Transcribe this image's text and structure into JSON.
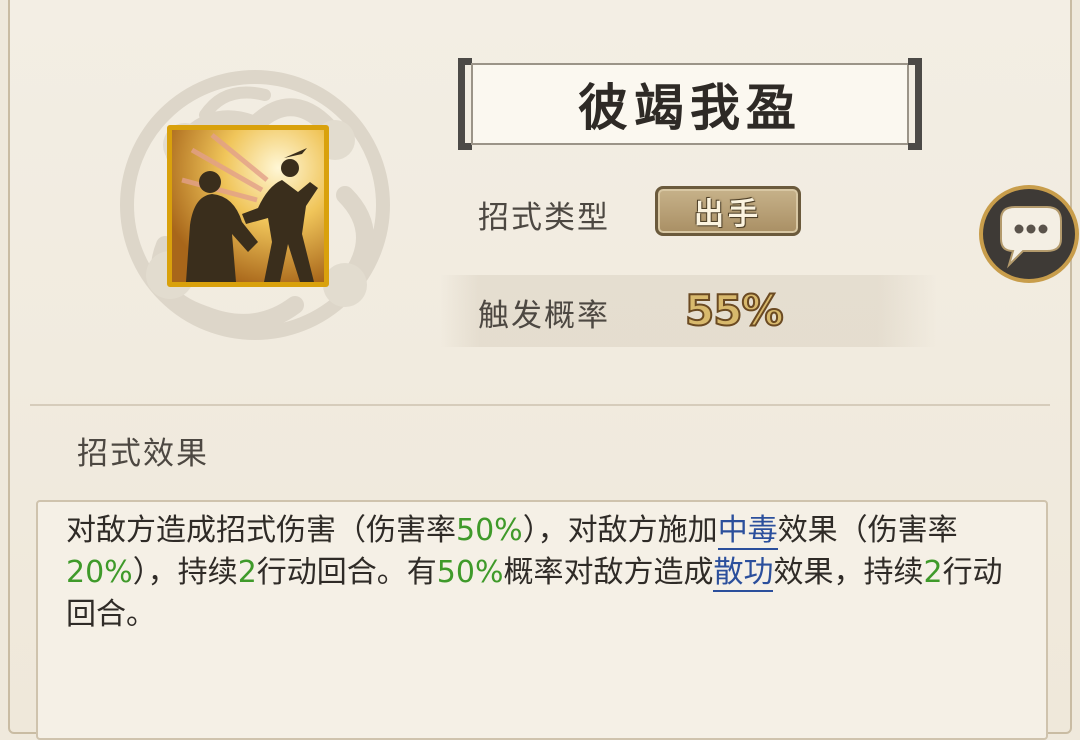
{
  "skill": {
    "name": "彼竭我盈",
    "icon": "martial-arts-fighters-icon",
    "type_label": "招式类型",
    "type_value": "出手",
    "trigger_label": "触发概率",
    "trigger_value": "55%"
  },
  "effects": {
    "section_title": "招式效果",
    "segments": [
      {
        "text": "对敌方造成招式伤害（伤害率",
        "style": "plain"
      },
      {
        "text": "50%",
        "style": "green"
      },
      {
        "text": "），对敌方施加",
        "style": "plain"
      },
      {
        "text": "中毒",
        "style": "keyword"
      },
      {
        "text": "效果（伤害率",
        "style": "plain"
      },
      {
        "text": "20%",
        "style": "green"
      },
      {
        "text": "），持续",
        "style": "plain"
      },
      {
        "text": "2",
        "style": "green"
      },
      {
        "text": "行动回合。有",
        "style": "plain"
      },
      {
        "text": "50%",
        "style": "green"
      },
      {
        "text": "概率对敌方造成",
        "style": "plain"
      },
      {
        "text": "散功",
        "style": "keyword"
      },
      {
        "text": "效果，持续",
        "style": "plain"
      },
      {
        "text": "2",
        "style": "green"
      },
      {
        "text": "行动回合。",
        "style": "plain"
      }
    ]
  },
  "chat": {
    "icon": "chat-bubble-ellipsis-icon"
  },
  "colors": {
    "background": "#efe9dc",
    "icon_border": "#d9a10c",
    "green_value": "#3f9a2a",
    "keyword_blue": "#2b4f9c",
    "badge_gold": "#c7b28a"
  }
}
